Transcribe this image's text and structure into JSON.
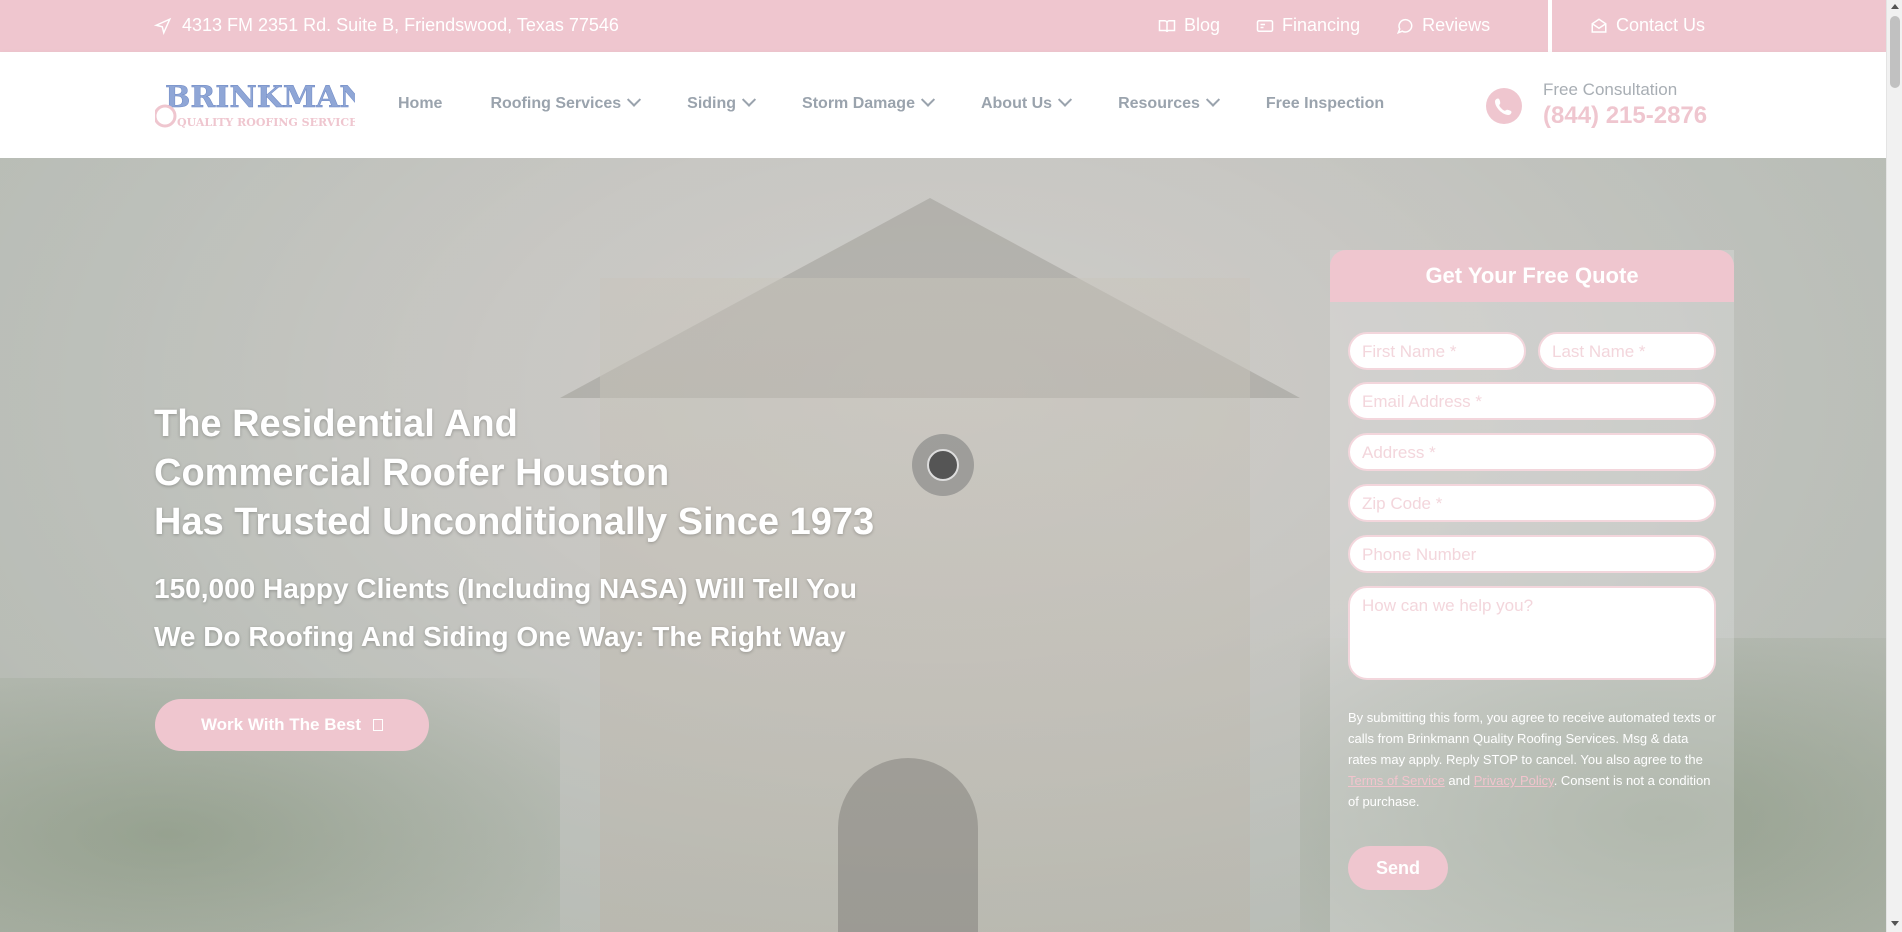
{
  "topbar": {
    "address": "4313 FM 2351 Rd. Suite B, Friendswood, Texas 77546",
    "links": [
      {
        "label": "Blog",
        "icon": "book-icon"
      },
      {
        "label": "Financing",
        "icon": "card-icon"
      },
      {
        "label": "Reviews",
        "icon": "chat-icon"
      }
    ],
    "contact_label": "Contact Us",
    "color": "#efc6cf"
  },
  "header": {
    "logo": {
      "line1": "BRINKMANN",
      "line2": "QUALITY ROOFING SERVICES, INC."
    },
    "nav": [
      {
        "label": "Home",
        "dropdown": false
      },
      {
        "label": "Roofing Services",
        "dropdown": true
      },
      {
        "label": "Siding",
        "dropdown": true
      },
      {
        "label": "Storm Damage",
        "dropdown": true
      },
      {
        "label": "About Us",
        "dropdown": true
      },
      {
        "label": "Resources",
        "dropdown": true
      },
      {
        "label": "Free Inspection",
        "dropdown": false
      }
    ],
    "consult_label": "Free Consultation",
    "phone": "(844) 215-2876"
  },
  "hero": {
    "headline": [
      "The Residential And",
      "Commercial Roofer Houston",
      "Has Trusted Unconditionally Since 1973"
    ],
    "subline": [
      "150,000 Happy Clients (Including NASA) Will Tell You",
      "We Do Roofing And Siding One Way: The Right Way"
    ],
    "cta_label": "Work With The Best"
  },
  "form": {
    "title": "Get Your Free Quote",
    "fields": {
      "first_name": "First Name *",
      "last_name": "Last Name *",
      "email": "Email Address *",
      "address": "Address *",
      "zip": "Zip Code *",
      "phone": "Phone Number",
      "message": "How can we help you?"
    },
    "disclaimer_pre": "By submitting this form, you agree to receive automated texts or calls from Brinkmann Quality Roofing Services. Msg & data rates may apply. Reply STOP to cancel. You also agree to the ",
    "terms": "Terms of Service",
    "and": " and ",
    "privacy": "Privacy Policy",
    "disclaimer_post": ". Consent is not a condition of purchase.",
    "send_label": "Send"
  }
}
